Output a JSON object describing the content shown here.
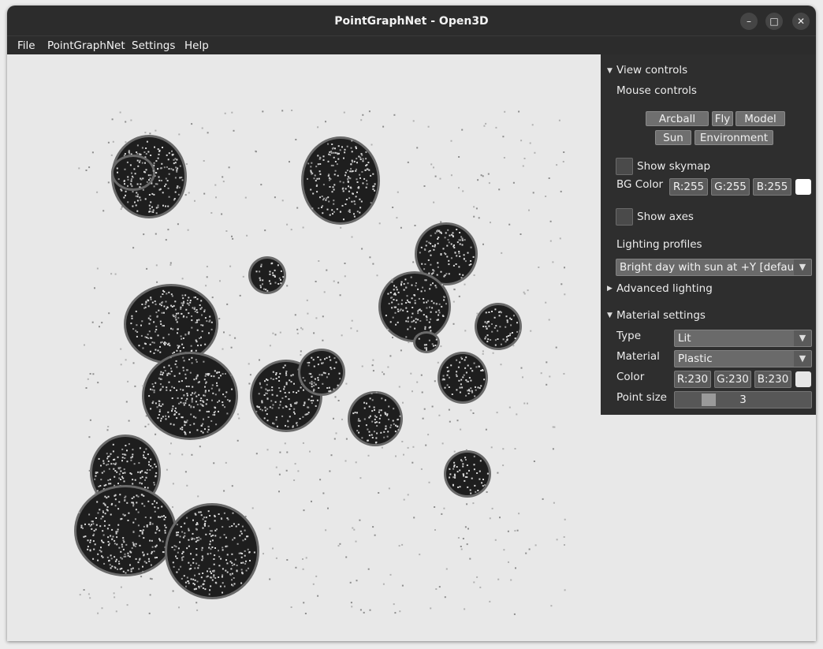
{
  "window": {
    "title": "PointGraphNet - Open3D",
    "controls": {
      "minimize": "–",
      "maximize": "□",
      "close": "✕"
    }
  },
  "menubar": [
    "File",
    "PointGraphNet",
    "Settings",
    "Help"
  ],
  "panel": {
    "view_controls": {
      "header": "View controls",
      "mouse_controls_label": "Mouse controls",
      "mouse_buttons": [
        "Arcball",
        "Fly",
        "Model",
        "Sun",
        "Environment"
      ],
      "show_skymap_label": "Show skymap",
      "show_skymap_checked": false,
      "bg_color_label": "BG Color",
      "bg_color": {
        "r": "R:255",
        "g": "G:255",
        "b": "B:255",
        "swatch": "#ffffff"
      },
      "show_axes_label": "Show axes",
      "show_axes_checked": false,
      "lighting_profiles_label": "Lighting profiles",
      "lighting_profile_value": "Bright day with sun at +Y [default]",
      "advanced_lighting_label": "Advanced lighting"
    },
    "material_settings": {
      "header": "Material settings",
      "type_label": "Type",
      "type_value": "Lit",
      "material_label": "Material",
      "material_value": "Plastic",
      "color_label": "Color",
      "color": {
        "r": "R:230",
        "g": "G:230",
        "b": "B:230",
        "swatch": "#e6e6e6"
      },
      "point_size_label": "Point size",
      "point_size_value": "3"
    }
  },
  "icons": {
    "expanded": "▼",
    "collapsed": "▶",
    "dropdown": "▼"
  },
  "colors": {
    "panel_bg": "#2e2e2e",
    "titlebar_bg": "#2c2c2c",
    "viewport_bg": "#e8e8e8",
    "blob_fill": "#1e1e1e"
  }
}
